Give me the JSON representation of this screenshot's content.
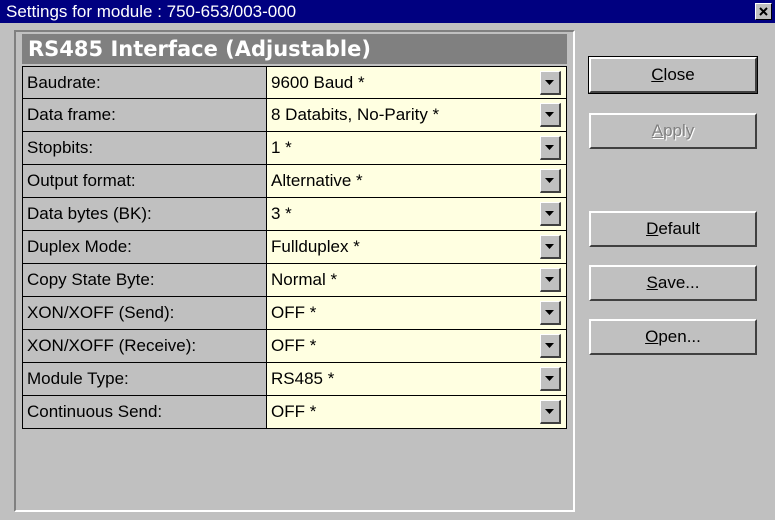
{
  "window": {
    "title": "Settings for module   : 750-653/003-000",
    "close_glyph": "×"
  },
  "panel": {
    "header": "RS485 Interface (Adjustable)",
    "rows": [
      {
        "label": "Baudrate:",
        "value": "9600 Baud *"
      },
      {
        "label": "Data frame:",
        "value": "8 Databits, No-Parity *"
      },
      {
        "label": "Stopbits:",
        "value": "1 *"
      },
      {
        "label": "Output format:",
        "value": "Alternative *"
      },
      {
        "label": "Data bytes (BK):",
        "value": "3 *"
      },
      {
        "label": "Duplex Mode:",
        "value": "Fullduplex *"
      },
      {
        "label": "Copy State Byte:",
        "value": "Normal *"
      },
      {
        "label": "XON/XOFF (Send):",
        "value": "OFF *"
      },
      {
        "label": "XON/XOFF (Receive):",
        "value": "OFF *"
      },
      {
        "label": "Module Type:",
        "value": "RS485 *"
      },
      {
        "label": "Continuous Send:",
        "value": "OFF *"
      }
    ]
  },
  "buttons": {
    "close": {
      "mnemonic": "C",
      "rest": "lose"
    },
    "apply": {
      "mnemonic": "A",
      "rest": "pply",
      "enabled": false
    },
    "default": {
      "mnemonic": "D",
      "rest": "efault"
    },
    "save": {
      "mnemonic": "S",
      "rest": "ave..."
    },
    "open": {
      "mnemonic": "O",
      "rest": "pen..."
    }
  },
  "colors": {
    "titlebar": "#000080",
    "face": "#c0c0c0",
    "value_background": "#ffffe1",
    "header_background": "#808080"
  },
  "icons": {
    "window_close": "close-icon",
    "dropdown": "chevron-down-icon"
  }
}
